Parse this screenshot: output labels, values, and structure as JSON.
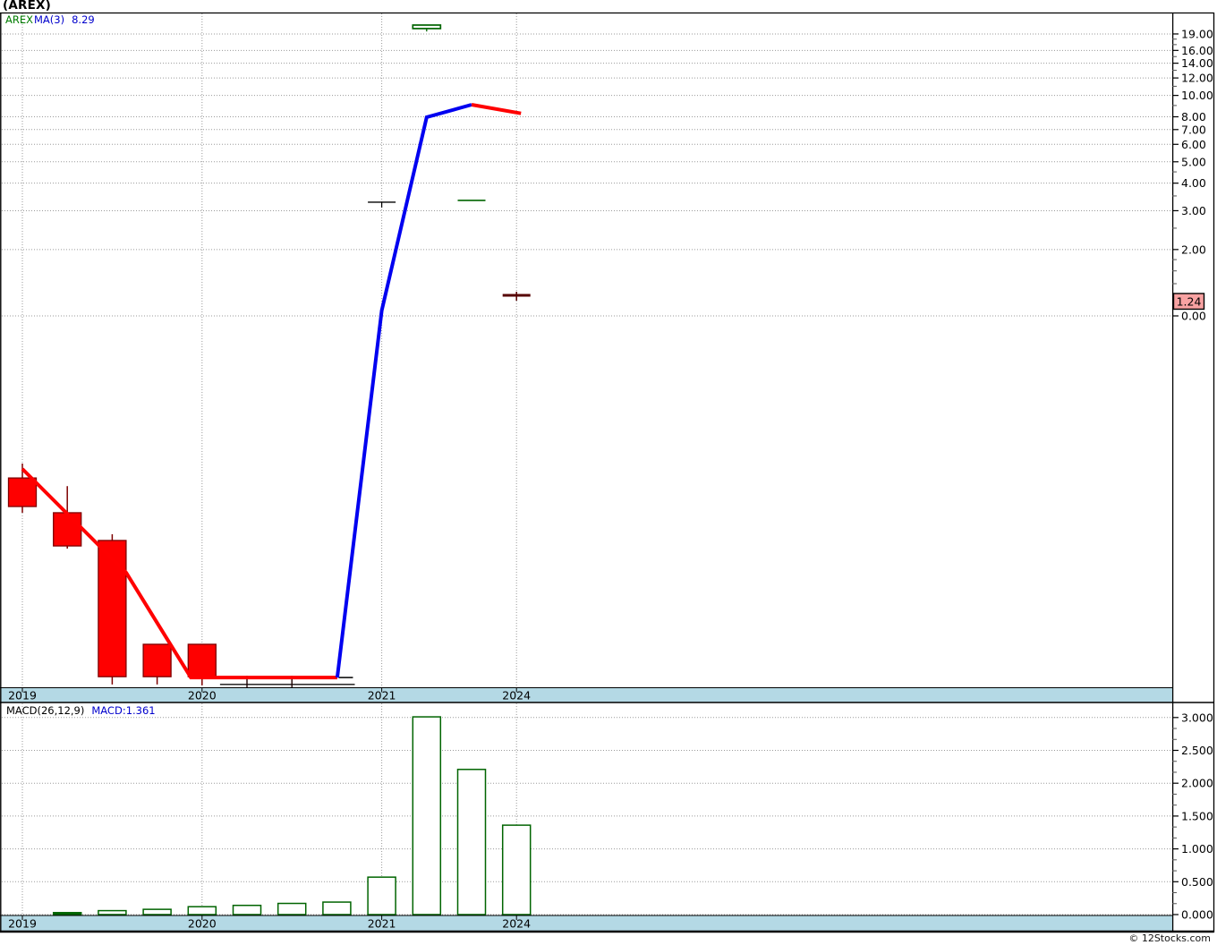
{
  "title": "(AREX)",
  "footer": {
    "copyright": "© 12Stocks.com"
  },
  "colors": {
    "up": "#006400",
    "down": "#fe0000",
    "down_border": "#7d0000",
    "ma_red": "#ff0000",
    "price_blue": "#0000f0",
    "band": "#b4d9e5",
    "grid": "#9a9a9a",
    "tag_fill": "#f8a2a2",
    "dark_mark": "#560000"
  },
  "chart_data": [
    {
      "type": "candlestick",
      "pane": "price",
      "title": "(AREX)",
      "legend": {
        "symbol": "AREX",
        "ma_label": "MA(3)",
        "ma_value": "8.29"
      },
      "x_axis": {
        "labels": [
          {
            "text": "2019",
            "i": 0
          },
          {
            "text": "2020",
            "i": 4
          },
          {
            "text": "2021",
            "i": 8
          },
          {
            "text": "2024",
            "i": 11
          }
        ]
      },
      "y_axis": {
        "scale": "log",
        "major": [
          19,
          16,
          14,
          12,
          10,
          8,
          7,
          6,
          5,
          4,
          3,
          2
        ],
        "minor": [
          18,
          17,
          15,
          13,
          11,
          9,
          4.5,
          3.5,
          2.5,
          1.8,
          1.6,
          1.4
        ],
        "zero_label": "0.00",
        "last_price_label": "1.24",
        "last_price_value": 1.24
      },
      "candles": [
        {
          "i": 0,
          "o": 0.184,
          "h": 0.214,
          "l": 0.128,
          "c": 0.1366,
          "style": "red"
        },
        {
          "i": 1,
          "o": 0.128,
          "h": 0.169,
          "l": 0.088,
          "c": 0.0905,
          "style": "red"
        },
        {
          "i": 2,
          "o": 0.0958,
          "h": 0.1022,
          "l": 0.0213,
          "c": 0.0231,
          "style": "red"
        },
        {
          "i": 3,
          "o": 0.0324,
          "h": 0.0324,
          "l": 0.0213,
          "c": 0.0231,
          "style": "red"
        },
        {
          "i": 4,
          "o": 0.0324,
          "h": 0.0324,
          "l": 0.0211,
          "c": 0.0231,
          "style": "red"
        },
        {
          "i": 5,
          "o": 0.0213,
          "h": 0.0233,
          "l": 0.0201,
          "c": 0.0213,
          "style": "dark-flat"
        },
        {
          "i": 6,
          "o": 0.0213,
          "h": 0.0233,
          "l": 0.0201,
          "c": 0.0213,
          "style": "dark-flat"
        },
        {
          "i": 7.2,
          "o": 0.0229,
          "h": 0.0229,
          "l": 0.0229,
          "c": 0.0229,
          "style": "black-dash"
        },
        {
          "i": 8,
          "o": 3.28,
          "h": 3.28,
          "l": 3.1,
          "c": 3.28,
          "style": "black-doji"
        },
        {
          "i": 9,
          "o": 20.85,
          "h": 20.85,
          "l": 19.5,
          "c": 20.1,
          "style": "green"
        },
        {
          "i": 10,
          "o": 3.34,
          "h": 3.34,
          "l": 3.34,
          "c": 3.34,
          "style": "green-dash"
        },
        {
          "i": 11,
          "o": 1.24,
          "h": 1.287,
          "l": 1.172,
          "c": 1.24,
          "style": "maroon-dash"
        }
      ],
      "base_line": {
        "from_i": 4.4,
        "to_i": 7.4,
        "v": 0.0213
      },
      "lines": [
        {
          "name": "ma-line-early",
          "color": "#ff0000",
          "width": 4,
          "points": [
            [
              0,
              0.2023
            ],
            [
              2.31,
              0.0685
            ],
            [
              3.75,
              0.0229
            ],
            [
              7.01,
              0.0229
            ]
          ]
        },
        {
          "name": "price-line-blue",
          "color": "#0000f0",
          "width": 4,
          "points": [
            [
              7.01,
              0.0229
            ],
            [
              8,
              1.058
            ],
            [
              9,
              7.96
            ],
            [
              10,
              9.08
            ]
          ]
        },
        {
          "name": "ma-line-late",
          "color": "#ff0000",
          "width": 4,
          "points": [
            [
              10,
              9.08
            ],
            [
              11.1,
              8.29
            ]
          ]
        }
      ]
    },
    {
      "type": "bar",
      "pane": "macd",
      "legend": {
        "label": "MACD(26,12,9)",
        "value": "MACD:1.361"
      },
      "x_axis": {
        "labels": [
          {
            "text": "2019",
            "i": 0
          },
          {
            "text": "2020",
            "i": 4
          },
          {
            "text": "2021",
            "i": 8
          },
          {
            "text": "2024",
            "i": 11
          }
        ]
      },
      "y_axis": {
        "major": [
          3.0,
          2.5,
          2.0,
          1.5,
          1.0,
          0.5,
          0.0
        ],
        "decimals": 3
      },
      "bars": [
        {
          "i": 1,
          "v": 0.03,
          "filled": true
        },
        {
          "i": 2,
          "v": 0.06
        },
        {
          "i": 3,
          "v": 0.08
        },
        {
          "i": 4,
          "v": 0.12
        },
        {
          "i": 5,
          "v": 0.14
        },
        {
          "i": 6,
          "v": 0.17
        },
        {
          "i": 7,
          "v": 0.19
        },
        {
          "i": 8,
          "v": 0.57
        },
        {
          "i": 9,
          "v": 3.01
        },
        {
          "i": 10,
          "v": 2.21
        },
        {
          "i": 11,
          "v": 1.361
        }
      ]
    }
  ]
}
